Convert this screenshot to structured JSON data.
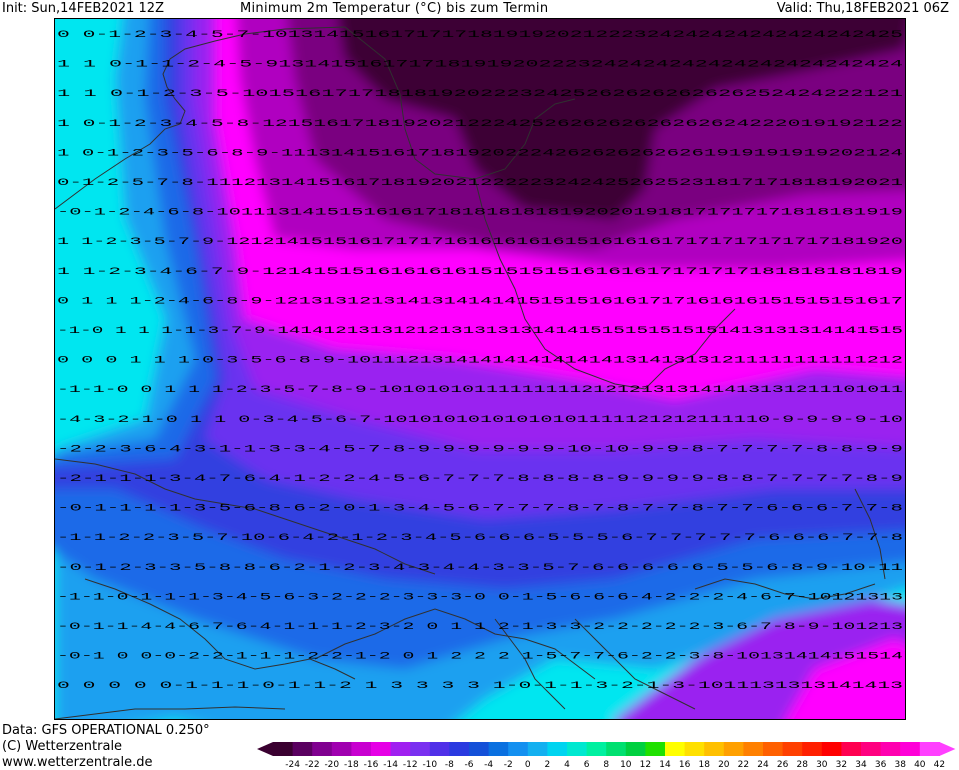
{
  "header": {
    "init": "Init: Sun,14FEB2021 12Z",
    "title": "Minimum 2m Temperatur (°C) bis zum Termin",
    "valid": "Valid: Thu,18FEB2021 06Z"
  },
  "footer": {
    "data_source": "Data: GFS OPERATIONAL 0.250°",
    "copyright": "(C) Wetterzentrale",
    "website": "www.wetterzentrale.de"
  },
  "legend": {
    "unit": "°C",
    "tick_labels": [
      "-24",
      "-22",
      "-20",
      "-18",
      "-16",
      "-14",
      "-12",
      "-10",
      "-8",
      "-6",
      "-4",
      "-2",
      "0",
      "2",
      "4",
      "6",
      "8",
      "10",
      "12",
      "14",
      "16",
      "18",
      "20",
      "22",
      "24",
      "26",
      "28",
      "30",
      "32",
      "34",
      "36",
      "38",
      "40",
      "42"
    ],
    "colors": [
      "#3a0030",
      "#5a0060",
      "#800090",
      "#a000b0",
      "#c800d0",
      "#e600e6",
      "#a020f0",
      "#7a30f0",
      "#5030e8",
      "#2a3ae0",
      "#1450d8",
      "#0a70e0",
      "#1490f0",
      "#14b0f0",
      "#00d4f0",
      "#00e8d0",
      "#00f0a0",
      "#00e070",
      "#00d040",
      "#20e000",
      "#ffff00",
      "#ffe000",
      "#ffc000",
      "#ffa000",
      "#ff8000",
      "#ff6000",
      "#ff4000",
      "#ff2000",
      "#ff0000",
      "#ff0050",
      "#ff0080",
      "#ff00b0",
      "#ff00d8",
      "#ff40ff"
    ]
  },
  "map": {
    "variable": "minimum 2m temperature",
    "colors": {
      "darkest": "#3d0036",
      "deep_purple": "#7a0080",
      "purple": "#b000c0",
      "magenta": "#ff00ff",
      "violet": "#9a20f0",
      "blue_violet": "#6a30f0",
      "blue": "#3040e0",
      "mid_blue": "#1e6ae8",
      "light_blue": "#1aa0f0",
      "cyan": "#00e6f0",
      "aqua": "#00ffe0",
      "coastline": "#303030"
    },
    "value_rows": [
      "0 0-1-2-3-4-5-7-10131415161717171819192021222324242424242424242425",
      "1 1 0-1-1-2-4-5-9131415161717181919202223242424242424242424242424",
      "1 1 0-1-2-3-5-10151617171818192022232425262626262626252424222121",
      "1 0-1-2-3-4-5-8-12151617181920212224252626262626262624222019192122",
      "1 0-1-2-3-5-6-8-9-11131415161718192022242626262626261919191919202124",
      "0-1-2-5-7-8-11121314151617181920212222232424252625231817171818192021",
      "-0-1-2-4-6-8-10111314151516161718181818181920201918171717171818181919",
      "1 1-2-3-5-7-9-12121415151617171716161616161516161617171717171717181920",
      "1 1-2-3-4-6-7-9-12141515161616161515151516161617171717181818181819",
      "0 1 1 1-2-4-6-8-9-1213131213141314141415151516161717161616151515151617",
      "-1-0 1 1 1-1-3-7-9-141412131312121313131314141515151515151413131314141515",
      "0 0 0 1 1 1-0-3-5-6-8-9-1011121314141414141414131413131211111111111212",
      "-1-1-0 0 1 1 1-2-3-5-7-8-9-10101010111111111212121313141413131211101011",
      "-4-3-2-1-0 1 1 0-3-4-5-6-7-10101010101010101111121212111110-9-9-9-9-10",
      "-2-2-3-6-4-3-1-1-3-3-4-5-7-8-9-9-9-9-9-9-10-10-9-9-8-7-7-7-7-8-8-9-9",
      "-2-1-1-1-3-4-7-6-4-1-2-2-4-5-6-7-7-7-8-8-8-8-9-9-9-9-8-8-7-7-7-7-8-9",
      "-0-1-1-1-1-3-5-6-8-6-2-0-1-3-4-5-6-7-7-7-8-7-8-7-7-8-7-7-6-6-6-7-7-8",
      "-1-1-2-2-3-5-7-10-6-4-2-1-2-3-4-5-6-6-6-5-5-5-6-7-7-7-7-7-6-6-6-7-7-8",
      "-0-1-2-3-3-5-8-8-6-2-1-2-3-4-3-4-4-3-3-5-7-6-6-6-6-6-5-5-6-8-9-10-11",
      "-1-1-0-1-1-1-3-4-5-6-3-2-2-2-3-3-3-0 0-1-5-6-6-6-4-2-2-2-4-6-7-10121313",
      "-0-1-1-4-4-6-7-6-4-1-1-1-2-3-2 0 1 1 2-1-3-3-2-2-2-2-2-3-6-7-8-9-101213",
      "-0-1 0 0-0-2-2-1-1-1-2-2-1-2 0 1 2 2 2 1-5-7-7-6-2-2-3-8-10131414151514",
      "0 0 0 0 0-1-1-1-0-1-1-2 1 3 3 3 3 1-0-1-1-3-2-1-3-1011131313141413"
    ]
  }
}
